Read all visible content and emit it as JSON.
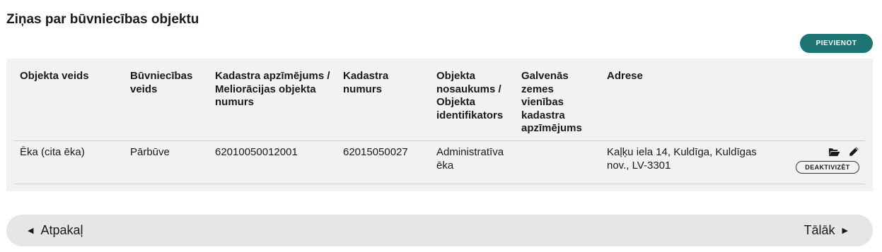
{
  "section": {
    "title": "Ziņas par būvniecības objektu",
    "add_label": "PIEVIENOT"
  },
  "table": {
    "headers": [
      "Objekta veids",
      "Būvniecības veids",
      "Kadastra apzīmējums / Meliorācijas objekta numurs",
      "Kadastra numurs",
      "Objekta nosaukums / Objekta identifikators",
      "Galvenās zemes vienības kadastra apzīmējums",
      "Adrese"
    ],
    "rows": [
      {
        "objekta_veids": "Ēka (cita ēka)",
        "buvniecibas_veids": "Pārbūve",
        "kadastra_apzimejums": "62010050012001",
        "kadastra_numurs": "62015050027",
        "objekta_nosaukums": "Administratīva ēka",
        "galvenas_zemes": "",
        "adrese": "Kaļķu iela 14, Kuldīga, Kuldīgas nov., LV-3301",
        "deactivate_label": "DEAKTIVIZĒT"
      }
    ]
  },
  "nav": {
    "back_label": "Atpakaļ",
    "next_label": "Tālāk"
  },
  "colors": {
    "accent": "#1e7373",
    "panel_bg": "#f2f2f2",
    "nav_bg": "#e6e6e6"
  },
  "icons": [
    "folder-open-icon",
    "pencil-icon",
    "caret-left-icon",
    "caret-right-icon"
  ]
}
